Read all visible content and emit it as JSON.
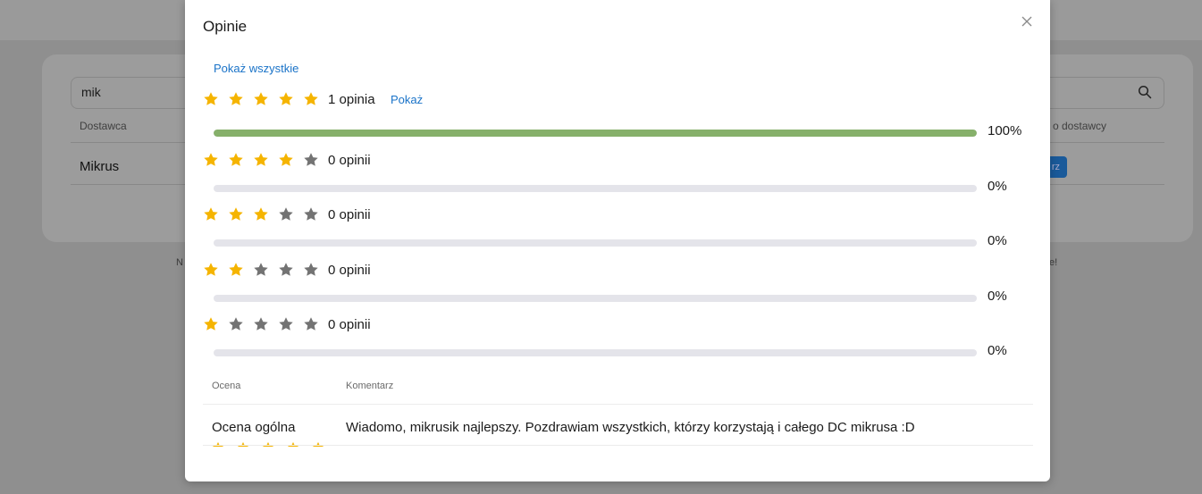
{
  "background": {
    "search_value": "mik",
    "columns": {
      "supplier": "Dostawca",
      "right_partial": "o dostawcy"
    },
    "row_supplier": "Mikrus",
    "row_button_partial": "rz",
    "footer_left_partial": "N",
    "footer_right_partial": "e!"
  },
  "modal": {
    "title": "Opinie",
    "show_all_label": "Pokaż wszystkie",
    "show_label": "Pokaż",
    "colors": {
      "star_filled": "#f5b400",
      "star_empty": "#737373",
      "bar_fill": "#86b06a",
      "bar_track": "#e4e4ea",
      "link": "#1a73c8"
    },
    "ratings": [
      {
        "stars": 5,
        "count_label": "1 opinia",
        "percent_label": "100%",
        "percent": 100,
        "has_show": true
      },
      {
        "stars": 4,
        "count_label": "0 opinii",
        "percent_label": "0%",
        "percent": 0,
        "has_show": false
      },
      {
        "stars": 3,
        "count_label": "0 opinii",
        "percent_label": "0%",
        "percent": 0,
        "has_show": false
      },
      {
        "stars": 2,
        "count_label": "0 opinii",
        "percent_label": "0%",
        "percent": 0,
        "has_show": false
      },
      {
        "stars": 1,
        "count_label": "0 opinii",
        "percent_label": "0%",
        "percent": 0,
        "has_show": false
      }
    ],
    "table": {
      "headers": {
        "rating": "Ocena",
        "comment": "Komentarz"
      },
      "rows": [
        {
          "rating": "Ocena ogólna",
          "stars": 5,
          "comment": "Wiadomo, mikrusik najlepszy. Pozdrawiam wszystkich, którzy korzystają i całego DC mikrusa :D"
        }
      ]
    }
  }
}
